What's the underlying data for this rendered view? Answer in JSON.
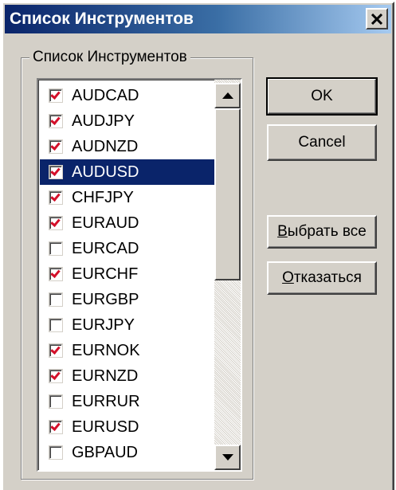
{
  "window": {
    "title": "Список Инструментов",
    "close_icon": "close-icon"
  },
  "group": {
    "label": "Список Инструментов"
  },
  "list": {
    "items": [
      {
        "label": "AUDCAD",
        "checked": true,
        "selected": false
      },
      {
        "label": "AUDJPY",
        "checked": true,
        "selected": false
      },
      {
        "label": "AUDNZD",
        "checked": true,
        "selected": false
      },
      {
        "label": "AUDUSD",
        "checked": true,
        "selected": true
      },
      {
        "label": "CHFJPY",
        "checked": true,
        "selected": false
      },
      {
        "label": "EURAUD",
        "checked": true,
        "selected": false
      },
      {
        "label": "EURCAD",
        "checked": false,
        "selected": false
      },
      {
        "label": "EURCHF",
        "checked": true,
        "selected": false
      },
      {
        "label": "EURGBP",
        "checked": false,
        "selected": false
      },
      {
        "label": "EURJPY",
        "checked": false,
        "selected": false
      },
      {
        "label": "EURNOK",
        "checked": true,
        "selected": false
      },
      {
        "label": "EURNZD",
        "checked": true,
        "selected": false
      },
      {
        "label": "EURRUR",
        "checked": false,
        "selected": false
      },
      {
        "label": "EURUSD",
        "checked": true,
        "selected": false
      },
      {
        "label": "GBPAUD",
        "checked": false,
        "selected": false
      }
    ],
    "scroll_position": 0
  },
  "buttons": {
    "ok": "OK",
    "cancel": "Cancel",
    "select_all": {
      "mnemonic": "В",
      "rest": "ыбрать все"
    },
    "decline": {
      "mnemonic": "О",
      "rest": "тказаться"
    }
  },
  "colors": {
    "titlebar_start": "#0a246a",
    "titlebar_end": "#a6caf0",
    "selection": "#0a246a",
    "checkmark": "#d4102a",
    "face": "#d4d0c8"
  }
}
